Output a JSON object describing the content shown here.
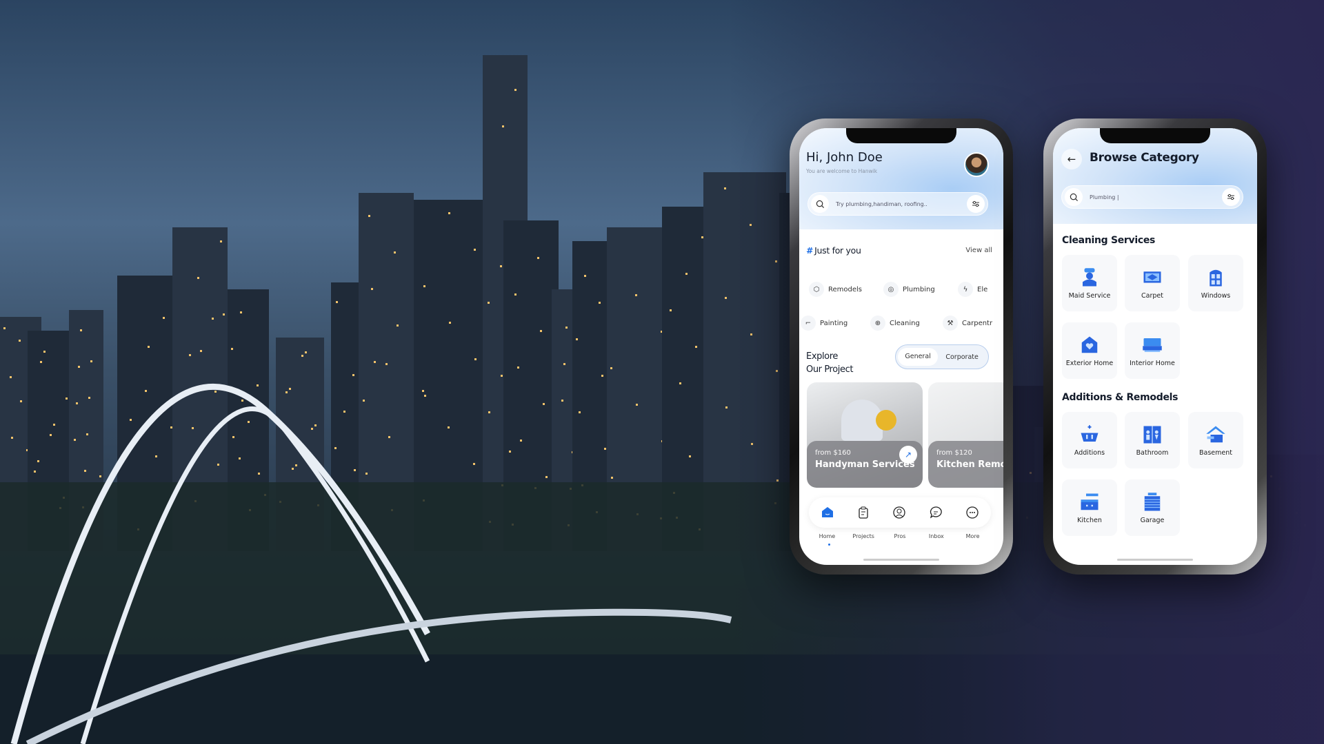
{
  "home_screen": {
    "greeting": "Hi, John Doe",
    "subtitle": "You are welcome to Hanwik",
    "search_placeholder": "Try plumbing,handiman, roofing..",
    "just_for_you": {
      "hash": "#",
      "title": "Just for you",
      "view_all": "View all"
    },
    "chips_row1": [
      {
        "label": "Remodels",
        "icon": "cube-icon"
      },
      {
        "label": "Plumbing",
        "icon": "drops-icon"
      },
      {
        "label": "Ele",
        "icon": "lightning-icon"
      }
    ],
    "chips_row2": [
      {
        "label": "Painting",
        "icon": "paint-roller-icon"
      },
      {
        "label": "Cleaning",
        "icon": "bucket-icon"
      },
      {
        "label": "Carpentr",
        "icon": "wrench-icon"
      }
    ],
    "explore": {
      "line1": "Explore",
      "line2": "Our Project"
    },
    "toggle": {
      "options": [
        "General",
        "Corporate"
      ],
      "selected": "General"
    },
    "cards": [
      {
        "price": "from $160",
        "title": "Handyman Services"
      },
      {
        "price": "from $120",
        "title": "Kitchen Remo"
      }
    ],
    "nav": [
      {
        "label": "Home",
        "icon": "home-icon",
        "active": true
      },
      {
        "label": "Projects",
        "icon": "clipboard-icon"
      },
      {
        "label": "Pros",
        "icon": "user-circle-icon"
      },
      {
        "label": "Inbox",
        "icon": "chat-icon"
      },
      {
        "label": "More",
        "icon": "more-icon"
      }
    ],
    "accent": "#1f6fe5"
  },
  "browse_screen": {
    "title": "Browse Category",
    "search_value": "Plumbing |",
    "sections": [
      {
        "title": "Cleaning Services",
        "items": [
          {
            "label": "Maid Service",
            "icon": "maid-icon"
          },
          {
            "label": "Carpet",
            "icon": "carpet-icon"
          },
          {
            "label": "Windows",
            "icon": "window-icon"
          },
          {
            "label": "Exterior Home",
            "icon": "house-heart-icon"
          },
          {
            "label": "Interior Home",
            "icon": "sofa-icon"
          }
        ]
      },
      {
        "title": "Additions & Remodels",
        "items": [
          {
            "label": "Additions",
            "icon": "basket-icon"
          },
          {
            "label": "Bathroom",
            "icon": "restroom-icon"
          },
          {
            "label": "Basement",
            "icon": "basement-icon"
          },
          {
            "label": "Kitchen",
            "icon": "kitchen-icon"
          },
          {
            "label": "Garage",
            "icon": "garage-icon"
          }
        ]
      }
    ]
  }
}
